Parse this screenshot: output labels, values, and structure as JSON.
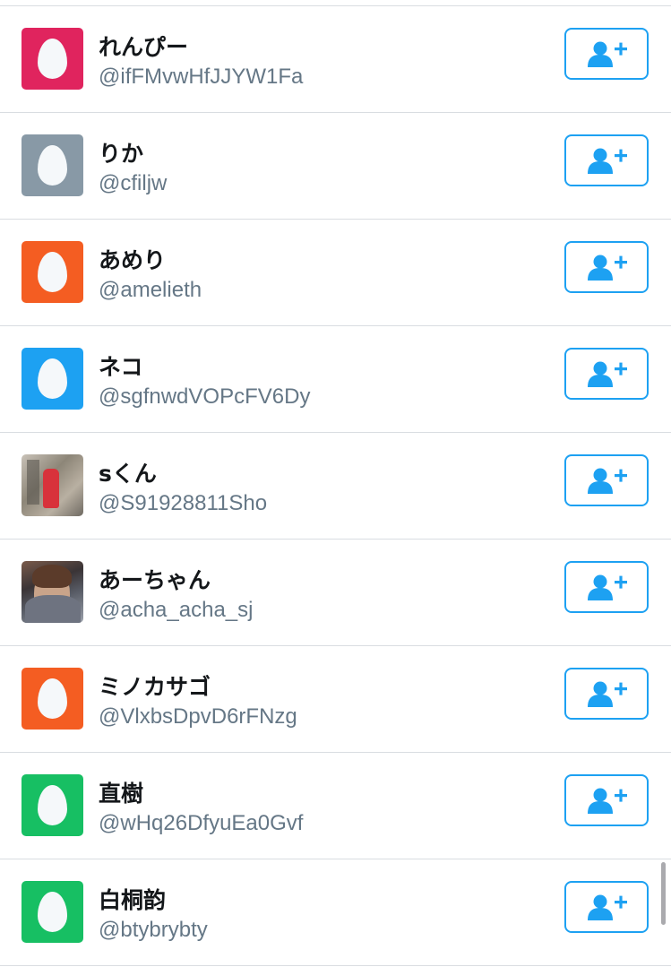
{
  "users": [
    {
      "name": "れんぴー",
      "handle": "@ifFMvwHfJJYW1Fa",
      "avatar": "egg",
      "avatar_color": "#e0245e"
    },
    {
      "name": "りか",
      "handle": "@cfiljw",
      "avatar": "egg",
      "avatar_color": "#8899a6"
    },
    {
      "name": "あめり",
      "handle": "@amelieth",
      "avatar": "egg",
      "avatar_color": "#f45d22"
    },
    {
      "name": "ネコ",
      "handle": "@sgfnwdVOPcFV6Dy",
      "avatar": "egg",
      "avatar_color": "#1da1f2"
    },
    {
      "name": "sくん",
      "handle": "@S91928811Sho",
      "avatar": "photo-1",
      "avatar_color": ""
    },
    {
      "name": "あーちゃん",
      "handle": "@acha_acha_sj",
      "avatar": "photo-2",
      "avatar_color": ""
    },
    {
      "name": "ミノカサゴ",
      "handle": "@VlxbsDpvD6rFNzg",
      "avatar": "egg",
      "avatar_color": "#f45d22"
    },
    {
      "name": "直樹",
      "handle": "@wHq26DfyuEa0Gvf",
      "avatar": "egg",
      "avatar_color": "#17bf63"
    },
    {
      "name": "白桐韵",
      "handle": "@btybrybty",
      "avatar": "egg",
      "avatar_color": "#17bf63"
    }
  ],
  "follow_button": {
    "icon": "add-user-icon",
    "color": "#1da1f2"
  },
  "colors": {
    "name": "#14171a",
    "handle": "#657786",
    "divider": "#d9dde1"
  }
}
